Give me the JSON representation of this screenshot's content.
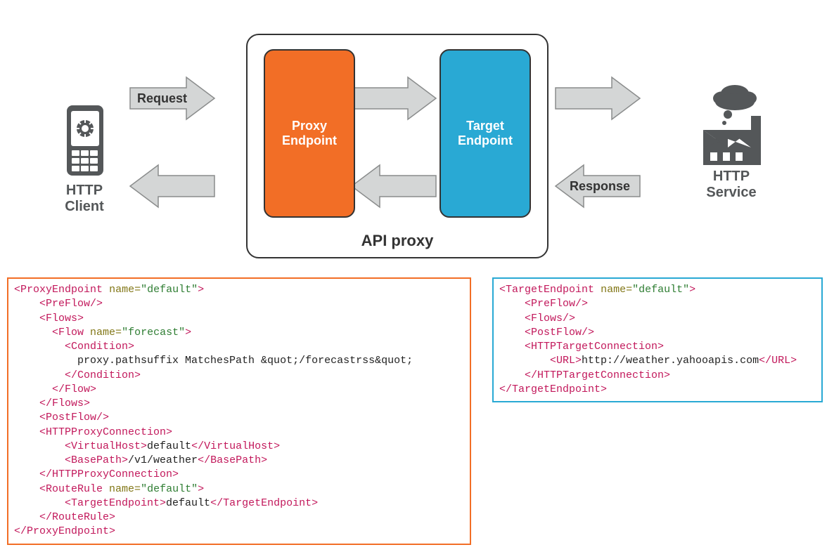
{
  "diagram": {
    "client_label": "HTTP Client",
    "service_label": "HTTP Service",
    "request_label": "Request",
    "response_label": "Response",
    "proxy_endpoint_line1": "Proxy",
    "proxy_endpoint_line2": "Endpoint",
    "target_endpoint_line1": "Target",
    "target_endpoint_line2": "Endpoint",
    "api_proxy_label": "API proxy"
  },
  "colors": {
    "orange": "#f26e26",
    "blue": "#29a9d4",
    "gray_icon": "#545759",
    "arrow_fill": "#d4d6d6",
    "arrow_stroke": "#8a8c8c"
  },
  "proxy_code": {
    "root_tag": "ProxyEndpoint",
    "root_name": "default",
    "flow_name": "forecast",
    "condition_text": "proxy.pathsuffix MatchesPath &quot;/forecastrss&quot;",
    "virtualhost": "default",
    "basepath": "/v1/weather",
    "routerule_name": "default",
    "target_endpoint": "default"
  },
  "target_code": {
    "root_tag": "TargetEndpoint",
    "root_name": "default",
    "url": "http://weather.yahooapis.com"
  }
}
